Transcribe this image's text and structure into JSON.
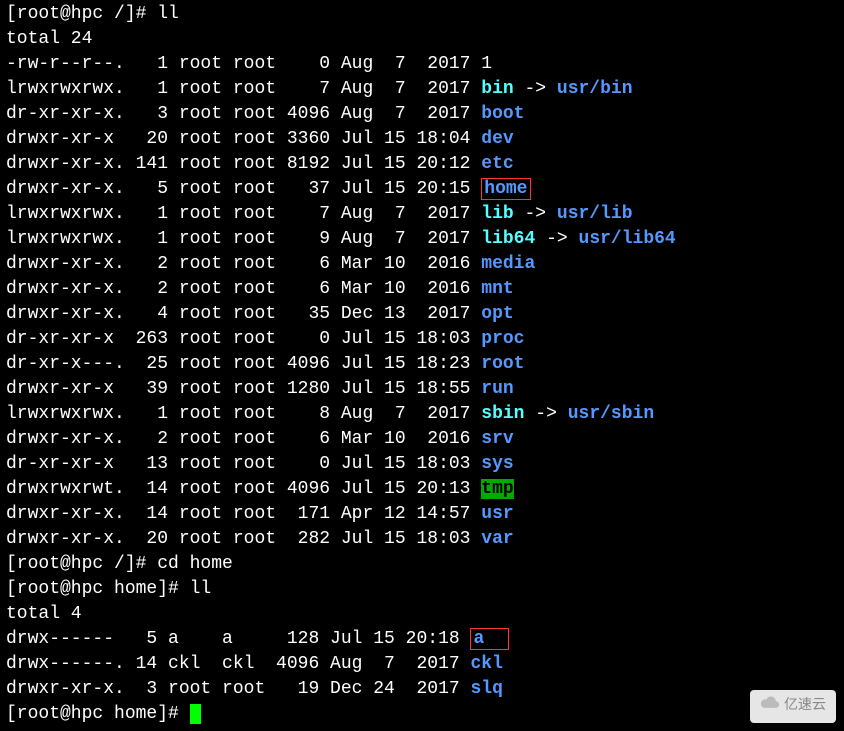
{
  "prompt1": "[root@hpc /]# ",
  "cmd1": "ll",
  "total1": "total 24",
  "ls": [
    {
      "perm": "-rw-r--r--.",
      "lnk": "  1",
      "own": "root",
      "grp": "root",
      "size": "   0",
      "date": "Aug  7  2017",
      "name": "1",
      "type": "file"
    },
    {
      "perm": "lrwxrwxrwx.",
      "lnk": "  1",
      "own": "root",
      "grp": "root",
      "size": "   7",
      "date": "Aug  7  2017",
      "name": "bin",
      "type": "link",
      "arrow": " -> ",
      "target": "usr/bin"
    },
    {
      "perm": "dr-xr-xr-x.",
      "lnk": "  3",
      "own": "root",
      "grp": "root",
      "size": "4096",
      "date": "Aug  7  2017",
      "name": "boot",
      "type": "dir"
    },
    {
      "perm": "drwxr-xr-x ",
      "lnk": " 20",
      "own": "root",
      "grp": "root",
      "size": "3360",
      "date": "Jul 15 18:04",
      "name": "dev",
      "type": "dir"
    },
    {
      "perm": "drwxr-xr-x.",
      "lnk": "141",
      "own": "root",
      "grp": "root",
      "size": "8192",
      "date": "Jul 15 20:12",
      "name": "etc",
      "type": "dir"
    },
    {
      "perm": "drwxr-xr-x.",
      "lnk": "  5",
      "own": "root",
      "grp": "root",
      "size": "  37",
      "date": "Jul 15 20:15",
      "name": "home",
      "type": "dir",
      "boxed": true
    },
    {
      "perm": "lrwxrwxrwx.",
      "lnk": "  1",
      "own": "root",
      "grp": "root",
      "size": "   7",
      "date": "Aug  7  2017",
      "name": "lib",
      "type": "link",
      "arrow": " -> ",
      "target": "usr/lib"
    },
    {
      "perm": "lrwxrwxrwx.",
      "lnk": "  1",
      "own": "root",
      "grp": "root",
      "size": "   9",
      "date": "Aug  7  2017",
      "name": "lib64",
      "type": "link",
      "arrow": " -> ",
      "target": "usr/lib64"
    },
    {
      "perm": "drwxr-xr-x.",
      "lnk": "  2",
      "own": "root",
      "grp": "root",
      "size": "   6",
      "date": "Mar 10  2016",
      "name": "media",
      "type": "dir"
    },
    {
      "perm": "drwxr-xr-x.",
      "lnk": "  2",
      "own": "root",
      "grp": "root",
      "size": "   6",
      "date": "Mar 10  2016",
      "name": "mnt",
      "type": "dir"
    },
    {
      "perm": "drwxr-xr-x.",
      "lnk": "  4",
      "own": "root",
      "grp": "root",
      "size": "  35",
      "date": "Dec 13  2017",
      "name": "opt",
      "type": "dir"
    },
    {
      "perm": "dr-xr-xr-x ",
      "lnk": "263",
      "own": "root",
      "grp": "root",
      "size": "   0",
      "date": "Jul 15 18:03",
      "name": "proc",
      "type": "dir"
    },
    {
      "perm": "dr-xr-x---.",
      "lnk": " 25",
      "own": "root",
      "grp": "root",
      "size": "4096",
      "date": "Jul 15 18:23",
      "name": "root",
      "type": "dir"
    },
    {
      "perm": "drwxr-xr-x ",
      "lnk": " 39",
      "own": "root",
      "grp": "root",
      "size": "1280",
      "date": "Jul 15 18:55",
      "name": "run",
      "type": "dir"
    },
    {
      "perm": "lrwxrwxrwx.",
      "lnk": "  1",
      "own": "root",
      "grp": "root",
      "size": "   8",
      "date": "Aug  7  2017",
      "name": "sbin",
      "type": "link",
      "arrow": " -> ",
      "target": "usr/sbin"
    },
    {
      "perm": "drwxr-xr-x.",
      "lnk": "  2",
      "own": "root",
      "grp": "root",
      "size": "   6",
      "date": "Mar 10  2016",
      "name": "srv",
      "type": "dir"
    },
    {
      "perm": "dr-xr-xr-x ",
      "lnk": " 13",
      "own": "root",
      "grp": "root",
      "size": "   0",
      "date": "Jul 15 18:03",
      "name": "sys",
      "type": "dir"
    },
    {
      "perm": "drwxrwxrwt.",
      "lnk": " 14",
      "own": "root",
      "grp": "root",
      "size": "4096",
      "date": "Jul 15 20:13",
      "name": "tmp",
      "type": "tmp"
    },
    {
      "perm": "drwxr-xr-x.",
      "lnk": " 14",
      "own": "root",
      "grp": "root",
      "size": " 171",
      "date": "Apr 12 14:57",
      "name": "usr",
      "type": "dir"
    },
    {
      "perm": "drwxr-xr-x.",
      "lnk": " 20",
      "own": "root",
      "grp": "root",
      "size": " 282",
      "date": "Jul 15 18:03",
      "name": "var",
      "type": "dir"
    }
  ],
  "prompt2": "[root@hpc /]# ",
  "cmd2": "cd home",
  "prompt3": "[root@hpc home]# ",
  "cmd3": "ll",
  "total2": "total 4",
  "ls2": [
    {
      "perm": "drwx------ ",
      "lnk": " 5",
      "own": "a   ",
      "grp": "a   ",
      "size": " 128",
      "date": "Jul 15 20:18",
      "name": "a",
      "type": "dir",
      "boxed": true,
      "pad": "  "
    },
    {
      "perm": "drwx------.",
      "lnk": "14",
      "own": "ckl ",
      "grp": "ckl ",
      "size": "4096",
      "date": "Aug  7  2017",
      "name": "ckl",
      "type": "dir"
    },
    {
      "perm": "drwxr-xr-x.",
      "lnk": " 3",
      "own": "root",
      "grp": "root",
      "size": "  19",
      "date": "Dec 24  2017",
      "name": "slq",
      "type": "dir"
    }
  ],
  "prompt4": "[root@hpc home]# ",
  "watermark": "亿速云"
}
